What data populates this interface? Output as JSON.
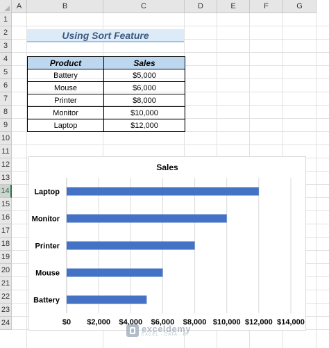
{
  "sheet": {
    "columns": [
      "A",
      "B",
      "C",
      "D",
      "E",
      "F",
      "G"
    ],
    "rows": [
      "1",
      "2",
      "3",
      "4",
      "5",
      "6",
      "7",
      "8",
      "9",
      "10",
      "11",
      "12",
      "13",
      "14",
      "15",
      "16",
      "17",
      "18",
      "19",
      "20",
      "21",
      "22",
      "23",
      "24"
    ],
    "selected_row": "14"
  },
  "title": "Using Sort Feature",
  "table": {
    "headers": [
      "Product",
      "Sales"
    ],
    "rows": [
      [
        "Battery",
        "$5,000"
      ],
      [
        "Mouse",
        "$6,000"
      ],
      [
        "Printer",
        "$8,000"
      ],
      [
        "Monitor",
        "$10,000"
      ],
      [
        "Laptop",
        "$12,000"
      ]
    ]
  },
  "chart_data": {
    "type": "bar",
    "orientation": "horizontal",
    "title": "Sales",
    "categories": [
      "Battery",
      "Mouse",
      "Printer",
      "Monitor",
      "Laptop"
    ],
    "values": [
      5000,
      6000,
      8000,
      10000,
      12000
    ],
    "xlim": [
      0,
      14000
    ],
    "xticks": [
      "$0",
      "$2,000",
      "$4,000",
      "$6,000",
      "$8,000",
      "$10,000",
      "$12,000",
      "$14,000"
    ],
    "bar_color": "#4472c4",
    "grid": true,
    "legend": "none"
  },
  "watermark": {
    "name": "exceldemy",
    "tagline": "EXCEL · DATA · BI"
  }
}
